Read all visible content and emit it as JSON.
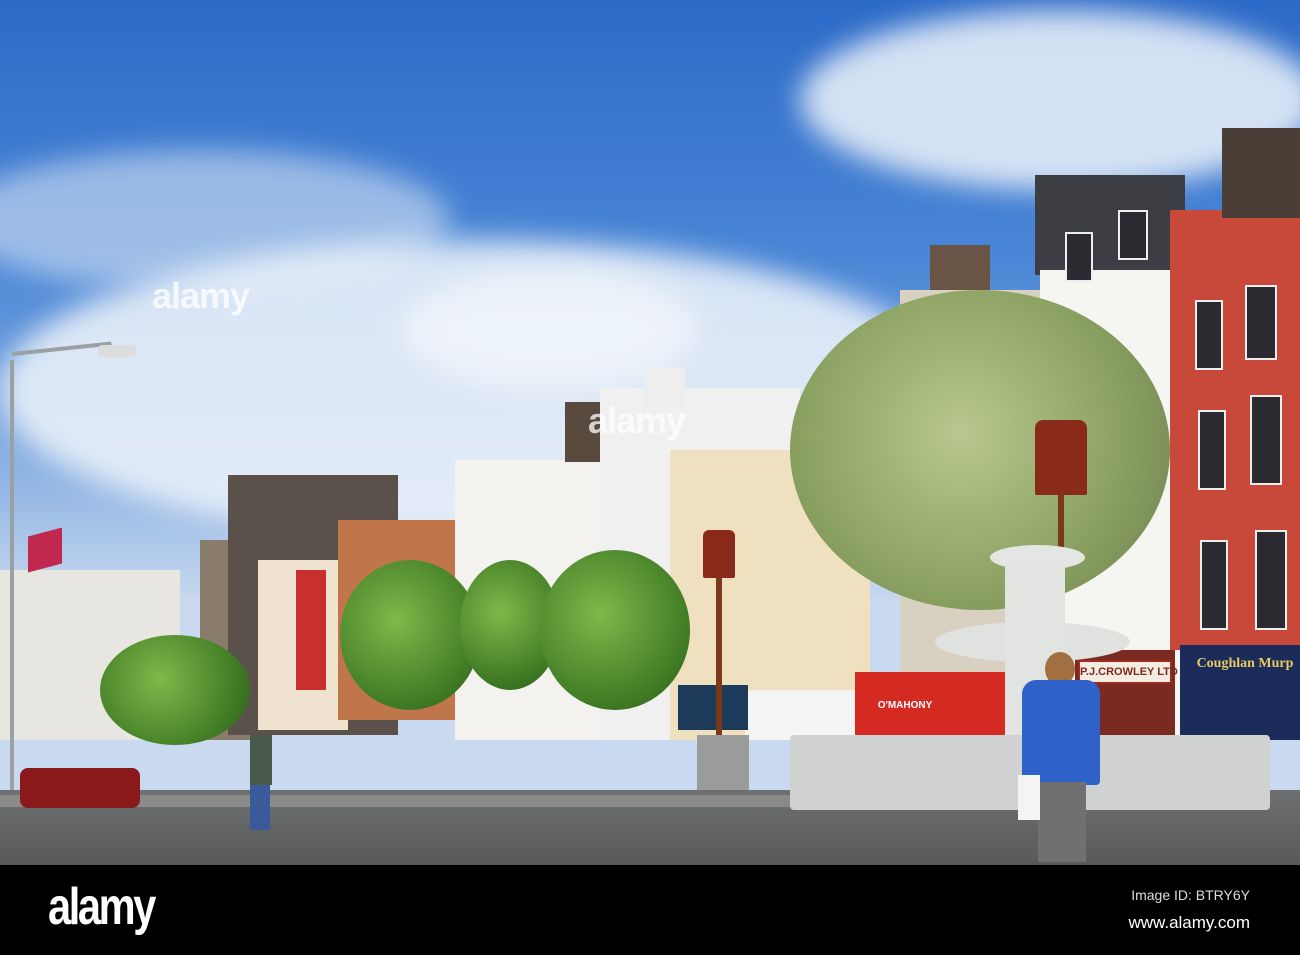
{
  "watermark": {
    "text": "alamy"
  },
  "signs": {
    "crowley": "P.J.CROWLEY LTD",
    "coughlan": "Coughlan Murp",
    "mahony": "O'MAHONY"
  },
  "footer": {
    "logo": "alamy",
    "image_id": "Image ID: BTRY6Y",
    "url": "www.alamy.com"
  },
  "colors": {
    "sky": "#3a78d0",
    "footer": "#000000",
    "red_building": "#c8483a"
  }
}
